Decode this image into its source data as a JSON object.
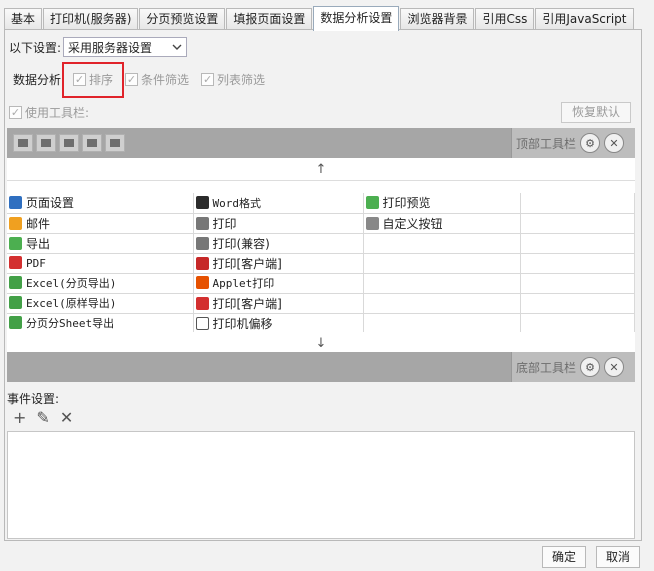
{
  "tabs": [
    {
      "label": "基本",
      "active": false
    },
    {
      "label": "打印机(服务器)",
      "active": false
    },
    {
      "label": "分页预览设置",
      "active": false
    },
    {
      "label": "填报页面设置",
      "active": false
    },
    {
      "label": "数据分析设置",
      "active": true
    },
    {
      "label": "浏览器背景",
      "active": false
    },
    {
      "label": "引用Css",
      "active": false
    },
    {
      "label": "引用JavaScript",
      "active": false
    }
  ],
  "settings": {
    "label": "以下设置:",
    "select_value": "采用服务器设置"
  },
  "analysis": {
    "label": "数据分析",
    "options": [
      "排序",
      "条件筛选",
      "列表筛选"
    ]
  },
  "toolbar": {
    "use_label": "使用工具栏:",
    "restore_label": "恢复默认",
    "top_label": "顶部工具栏",
    "bottom_label": "底部工具栏",
    "up_arrow": "↑",
    "down_arrow": "↓",
    "gear_glyph": "⚙",
    "close_glyph": "✕"
  },
  "grid": {
    "rows": [
      [
        "页面设置",
        "Word格式",
        "打印预览"
      ],
      [
        "邮件",
        "打印",
        "自定义按钮"
      ],
      [
        "导出",
        "打印(兼容)",
        ""
      ],
      [
        "PDF",
        "打印[客户端]",
        ""
      ],
      [
        "Excel(分页导出)",
        "Applet打印",
        ""
      ],
      [
        "Excel(原样导出)",
        "打印[客户端]",
        ""
      ],
      [
        "分页分Sheet导出",
        "打印机偏移",
        ""
      ]
    ]
  },
  "events": {
    "label": "事件设置:",
    "add_glyph": "+",
    "edit_glyph": "✎",
    "delete_glyph": "✕"
  },
  "footer": {
    "ok_label": "确定",
    "cancel_label": "取消"
  }
}
